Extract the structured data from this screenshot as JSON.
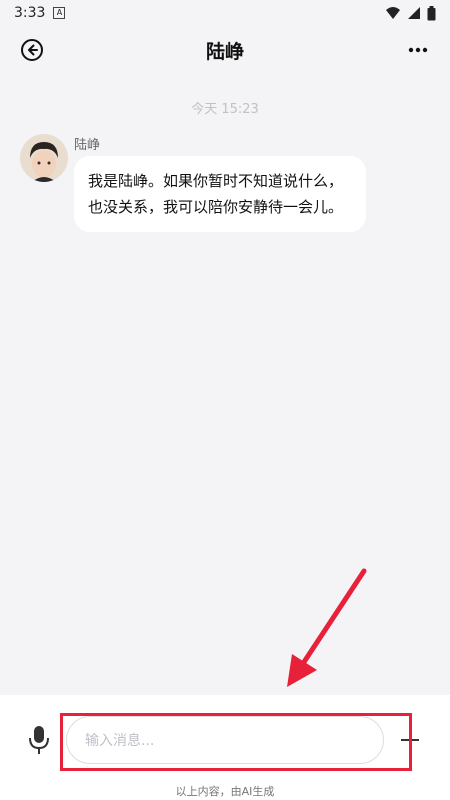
{
  "status_bar": {
    "time": "3:33"
  },
  "header": {
    "title": "陆峥"
  },
  "chat": {
    "timestamp": "今天 15:23",
    "messages": [
      {
        "sender": "陆峥",
        "text": "我是陆峥。如果你暂时不知道说什么，也没关系，我可以陪你安静待一会儿。"
      }
    ]
  },
  "composer": {
    "placeholder": "输入消息..."
  },
  "footer": {
    "disclaimer": "以上内容，由AI生成"
  },
  "colors": {
    "background": "#f4f4f6",
    "bubble": "#ffffff",
    "highlight": "#e8213a"
  },
  "icons": [
    "back-icon",
    "more-icon",
    "microphone-icon",
    "plus-icon",
    "wifi-icon",
    "signal-icon",
    "battery-icon"
  ]
}
